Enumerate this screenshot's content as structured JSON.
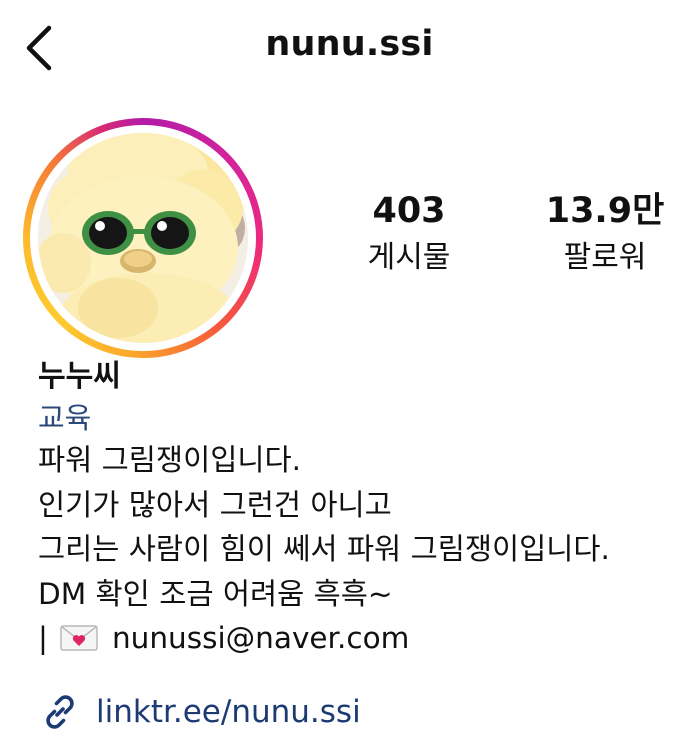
{
  "header": {
    "username": "nunu.ssi"
  },
  "stats": {
    "posts": {
      "value": "403",
      "label": "게시물"
    },
    "followers": {
      "value": "13.9만",
      "label": "팔로워"
    }
  },
  "profile": {
    "display_name": "누누씨",
    "category": "교육",
    "bio_lines": [
      "파워 그림쟁이입니다.",
      "인기가 많아서 그런건 아니고",
      "그리는 사람이 힘이 쎄서 파워 그림쟁이입니다.",
      "DM 확인 조금 어려움 흑흑~"
    ],
    "email_prefix": "|",
    "email": "nunussi@naver.com",
    "link": "linktr.ee/nunu.ssi"
  },
  "icons": {
    "back": "chevron-left-icon",
    "email": "love-letter-icon",
    "link": "link-icon"
  },
  "colors": {
    "category": "#2b4a79",
    "link": "#1d3b73",
    "text": "#111111"
  }
}
